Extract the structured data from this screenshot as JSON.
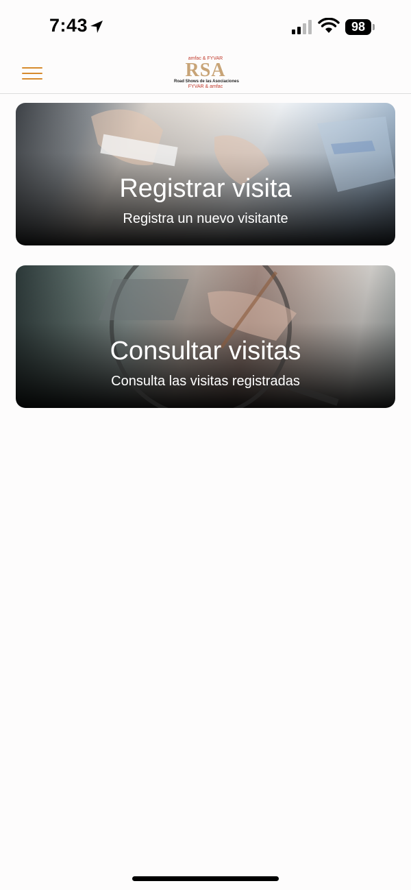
{
  "status_bar": {
    "time": "7:43",
    "battery": "98"
  },
  "header": {
    "logo": {
      "top_text": "amfac & FYVAR",
      "main": "RSA",
      "subtitle": "Road Shows de las Asociaciones",
      "bottom_text": "FYVAR & amfac"
    },
    "menu_icon": "hamburger-icon"
  },
  "cards": [
    {
      "title": "Registrar visita",
      "subtitle": "Registra un nuevo visitante"
    },
    {
      "title": "Consultar visitas",
      "subtitle": "Consulta las visitas registradas"
    }
  ],
  "colors": {
    "accent": "#d68a2c",
    "logo_gold": "#c8a477",
    "background": "#fdfcfc"
  }
}
